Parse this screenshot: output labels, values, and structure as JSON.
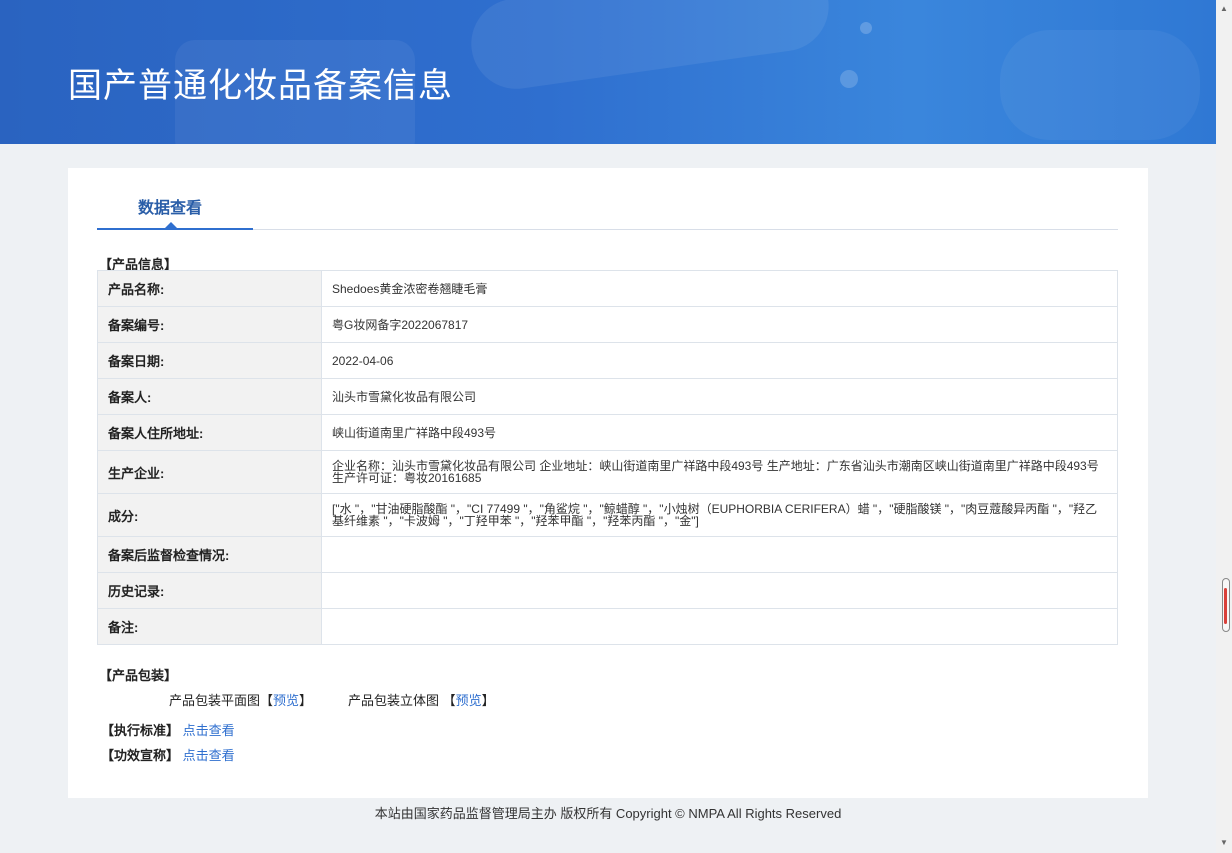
{
  "header": {
    "title": "国产普通化妆品备案信息"
  },
  "tab": {
    "label": "数据查看"
  },
  "product_info": {
    "section_label": "【产品信息】",
    "rows": [
      {
        "key": "产品名称:",
        "value": "Shedoes黄金浓密卷翘睫毛膏"
      },
      {
        "key": "备案编号:",
        "value": "粤G妆网备字2022067817"
      },
      {
        "key": "备案日期:",
        "value": "2022-04-06"
      },
      {
        "key": "备案人:",
        "value": "汕头市雪黛化妆品有限公司"
      },
      {
        "key": "备案人住所地址:",
        "value": "峡山街道南里广祥路中段493号"
      },
      {
        "key": "生产企业:",
        "value": "企业名称：汕头市雪黛化妆品有限公司 企业地址：峡山街道南里广祥路中段493号 生产地址：广东省汕头市潮南区峡山街道南里广祥路中段493号 生产许可证：粤妆20161685"
      },
      {
        "key": "成分:",
        "value": "[\"水 \"，\"甘油硬脂酸酯 \"，\"CI 77499 \"，\"角鲨烷 \"，\"鲸蜡醇 \"，\"小烛树（EUPHORBIA CERIFERA）蜡 \"，\"硬脂酸镁 \"，\"肉豆蔻酸异丙酯 \"，\"羟乙基纤维素 \"，\"卡波姆 \"，\"丁羟甲苯 \"，\"羟苯甲酯 \"，\"羟苯丙酯 \"，\"金\"]"
      },
      {
        "key": "备案后监督检查情况:",
        "value": ""
      },
      {
        "key": "历史记录:",
        "value": ""
      },
      {
        "key": "备注:",
        "value": ""
      }
    ]
  },
  "packaging": {
    "section_label": "【产品包装】",
    "flat_label": "产品包装平面图",
    "solid_label": "产品包装立体图",
    "bracket_open": "【",
    "bracket_close": "】",
    "preview_link": "预览"
  },
  "standard": {
    "label": "【执行标准】",
    "link": "点击查看"
  },
  "efficacy": {
    "label": "【功效宣称】",
    "link": "点击查看"
  },
  "footer": {
    "text": "本站由国家药品监督管理局主办 版权所有 Copyright © NMPA All Rights Reserved"
  }
}
